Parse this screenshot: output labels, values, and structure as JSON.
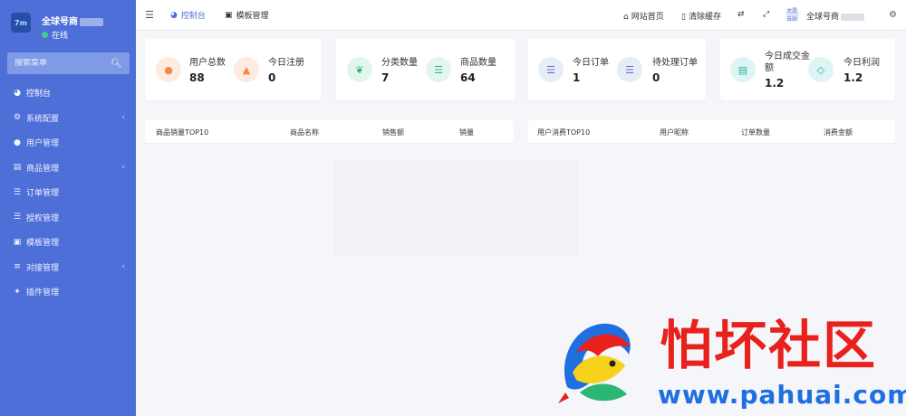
{
  "brand": {
    "logo_text": "7m",
    "name": "全球号商",
    "status": "在线"
  },
  "sidebar": {
    "search_placeholder": "搜索菜单",
    "items": [
      {
        "label": "控制台",
        "icon": "dashboard-icon",
        "active": true,
        "has_children": false
      },
      {
        "label": "系统配置",
        "icon": "gear-icon",
        "has_children": true
      },
      {
        "label": "用户管理",
        "icon": "user-icon",
        "has_children": false
      },
      {
        "label": "商品管理",
        "icon": "cart-icon",
        "has_children": true
      },
      {
        "label": "订单管理",
        "icon": "list-icon",
        "has_children": false
      },
      {
        "label": "授权管理",
        "icon": "list-icon",
        "has_children": false
      },
      {
        "label": "模板管理",
        "icon": "template-icon",
        "has_children": false
      },
      {
        "label": "对接管理",
        "icon": "sliders-icon",
        "has_children": true
      },
      {
        "label": "插件管理",
        "icon": "plugin-icon",
        "has_children": false
      }
    ]
  },
  "header": {
    "tabs": [
      {
        "label": "控制台",
        "icon": "dashboard-icon",
        "active": true
      },
      {
        "label": "模板管理",
        "icon": "template-icon",
        "active": false
      }
    ],
    "links": [
      {
        "label": "网站首页",
        "icon": "home-icon"
      },
      {
        "label": "清除缓存",
        "icon": "trash-icon"
      }
    ],
    "user": {
      "name": "全球号商",
      "avatar_text": "大灵云站"
    }
  },
  "stats": [
    {
      "label": "用户总数",
      "value": "88",
      "icon": "users-icon",
      "color": "#f08a4b"
    },
    {
      "label": "今日注册",
      "value": "0",
      "icon": "user-icon",
      "color": "#f08a4b"
    },
    {
      "label": "分类数量",
      "value": "7",
      "icon": "leaf-icon",
      "color": "#2fb380"
    },
    {
      "label": "商品数量",
      "value": "64",
      "icon": "list-icon",
      "color": "#2fb380"
    },
    {
      "label": "今日订单",
      "value": "1",
      "icon": "menu-icon",
      "color": "#5a78c7"
    },
    {
      "label": "待处理订单",
      "value": "0",
      "icon": "menu-icon",
      "color": "#5a78c7"
    },
    {
      "label_line1": "今日成交金",
      "label_line2": "额",
      "value": "1.2",
      "icon": "cart-icon",
      "color": "#27b0a5"
    },
    {
      "label": "今日利润",
      "value": "1.2",
      "icon": "diamond-icon",
      "color": "#27b0a5"
    }
  ],
  "tables": {
    "product_sales": {
      "headers": [
        "商品销量TOP10",
        "商品名称",
        "销售额",
        "销量"
      ]
    },
    "user_spend": {
      "headers": [
        "用户消费TOP10",
        "用户昵称",
        "订单数量",
        "消费金额"
      ]
    }
  },
  "watermark": {
    "title": "怕坏社区",
    "url": "www.pahuai.com"
  },
  "colors": {
    "sidebar": "#4f6fd8",
    "accent": "#4f6fd8",
    "watermark_red": "#e8211c",
    "watermark_blue": "#1f6fe0"
  }
}
